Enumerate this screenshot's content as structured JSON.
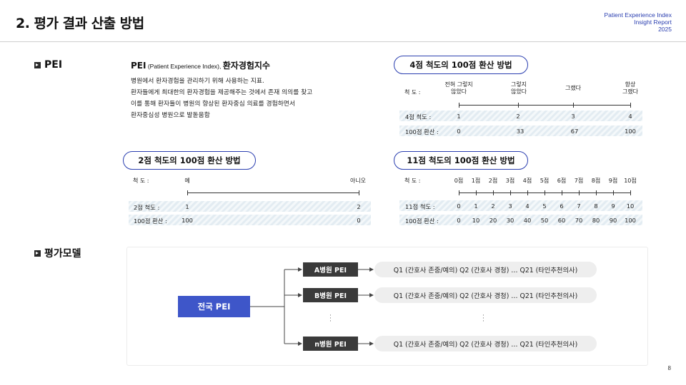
{
  "header": {
    "title": "2. 평가 결과 산출 방법",
    "report_lines": [
      "Patient Experience Index",
      "Insight Report",
      "2025"
    ]
  },
  "page_number": "8",
  "pei": {
    "section": "PEI",
    "title_main": "PEI",
    "title_sub": " (Patient Experience Index), ",
    "title_kr": "환자경험지수",
    "desc": [
      "병원에서 환자경험을 관리하기 위해 사용하는 지표.",
      "환자들에게 최대한의 환자경험을 제공해주는 것에서 존재 의의를 찾고",
      "이를 통해 환자들이 병원의 향상된 환자중심 의료를 경험하면서",
      "환자중심성 병원으로 발돋움함"
    ]
  },
  "scale4": {
    "title": "4점 척도의 100점 환산 방법",
    "scale_label": "척     도 :",
    "anchors": [
      "전혀 그렇지\n않았다",
      "그렇지\n않았다",
      "그랬다",
      "항상\n그랬다"
    ],
    "row1_label": "4점 척도 :",
    "row1": [
      "1",
      "2",
      "3",
      "4"
    ],
    "row2_label": "100점 환산 :",
    "row2": [
      "0",
      "33",
      "67",
      "100"
    ]
  },
  "scale2": {
    "title": "2점 척도의 100점 환산 방법",
    "scale_label": "척     도 :",
    "anchors": [
      "예",
      "아니오"
    ],
    "row1_label": "2점 척도 :",
    "row1": [
      "1",
      "2"
    ],
    "row2_label": "100점 환산 :",
    "row2": [
      "100",
      "0"
    ]
  },
  "scale11": {
    "title": "11점 척도의 100점 환산 방법",
    "scale_label": "척     도 :",
    "anchors": [
      "0점",
      "1점",
      "2점",
      "3점",
      "4점",
      "5점",
      "6점",
      "7점",
      "8점",
      "9점",
      "10점"
    ],
    "row1_label": "11점 척도 :",
    "row1": [
      "0",
      "1",
      "2",
      "3",
      "4",
      "5",
      "6",
      "7",
      "8",
      "9",
      "10"
    ],
    "row2_label": "100점 환산 :",
    "row2": [
      "0",
      "10",
      "20",
      "30",
      "40",
      "50",
      "60",
      "70",
      "80",
      "90",
      "100"
    ]
  },
  "model": {
    "section": "평가모델",
    "national": "전국 PEI",
    "hospitals": [
      {
        "name": "A병원 PEI",
        "questions": "Q1 (간호사 존중/예의)  Q2 (간호사 경청)  …  Q21 (타인추천의사)"
      },
      {
        "name": "B병원 PEI",
        "questions": "Q1 (간호사 존중/예의)  Q2 (간호사 경청)  …  Q21 (타인추천의사)"
      },
      {
        "name": "n병원 PEI",
        "questions": "Q1 (간호사 존중/예의)  Q2 (간호사 경청)  …  Q21 (타인추천의사)"
      }
    ]
  }
}
